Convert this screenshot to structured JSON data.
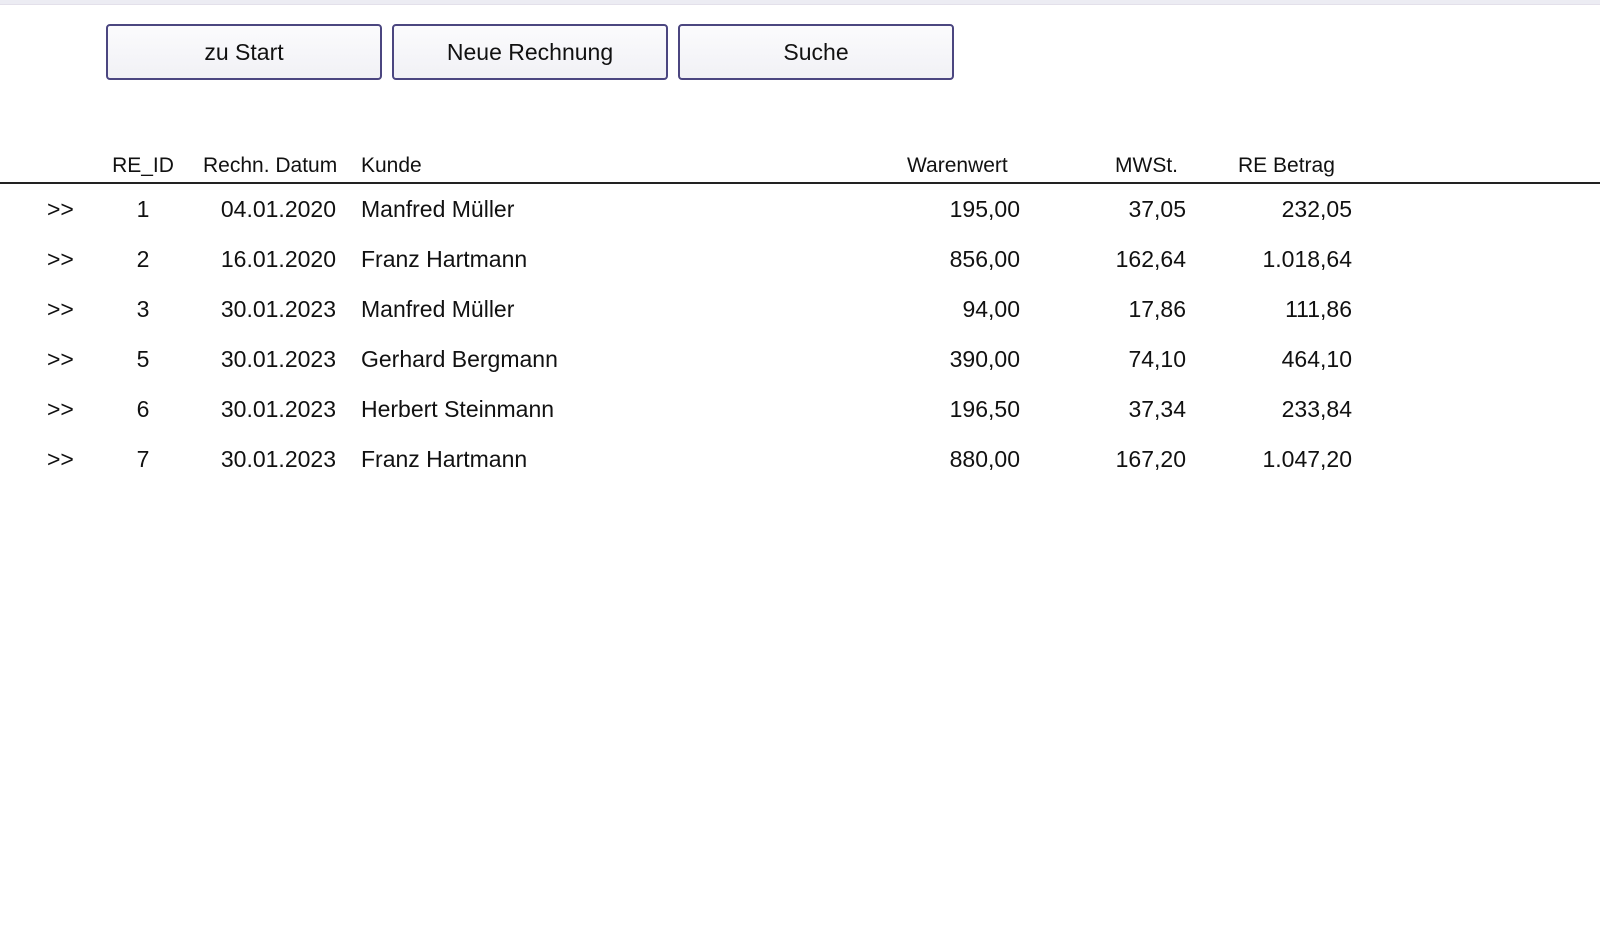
{
  "toolbar": {
    "start_label": "zu Start",
    "new_invoice_label": "Neue Rechnung",
    "search_label": "Suche"
  },
  "table": {
    "headers": {
      "id": "RE_ID",
      "date": "Rechn. Datum",
      "customer": "Kunde",
      "goods_value": "Warenwert",
      "vat": "MWSt.",
      "amount": "RE Betrag"
    },
    "rows": [
      {
        "arrow": ">>",
        "id": "1",
        "date": "04.01.2020",
        "customer": "Manfred Müller",
        "goods_value": "195,00",
        "vat": "37,05",
        "amount": "232,05"
      },
      {
        "arrow": ">>",
        "id": "2",
        "date": "16.01.2020",
        "customer": "Franz Hartmann",
        "goods_value": "856,00",
        "vat": "162,64",
        "amount": "1.018,64"
      },
      {
        "arrow": ">>",
        "id": "3",
        "date": "30.01.2023",
        "customer": "Manfred Müller",
        "goods_value": "94,00",
        "vat": "17,86",
        "amount": "111,86"
      },
      {
        "arrow": ">>",
        "id": "5",
        "date": "30.01.2023",
        "customer": "Gerhard Bergmann",
        "goods_value": "390,00",
        "vat": "74,10",
        "amount": "464,10"
      },
      {
        "arrow": ">>",
        "id": "6",
        "date": "30.01.2023",
        "customer": "Herbert Steinmann",
        "goods_value": "196,50",
        "vat": "37,34",
        "amount": "233,84"
      },
      {
        "arrow": ">>",
        "id": "7",
        "date": "30.01.2023",
        "customer": "Franz Hartmann",
        "goods_value": "880,00",
        "vat": "167,20",
        "amount": "1.047,20"
      }
    ]
  }
}
